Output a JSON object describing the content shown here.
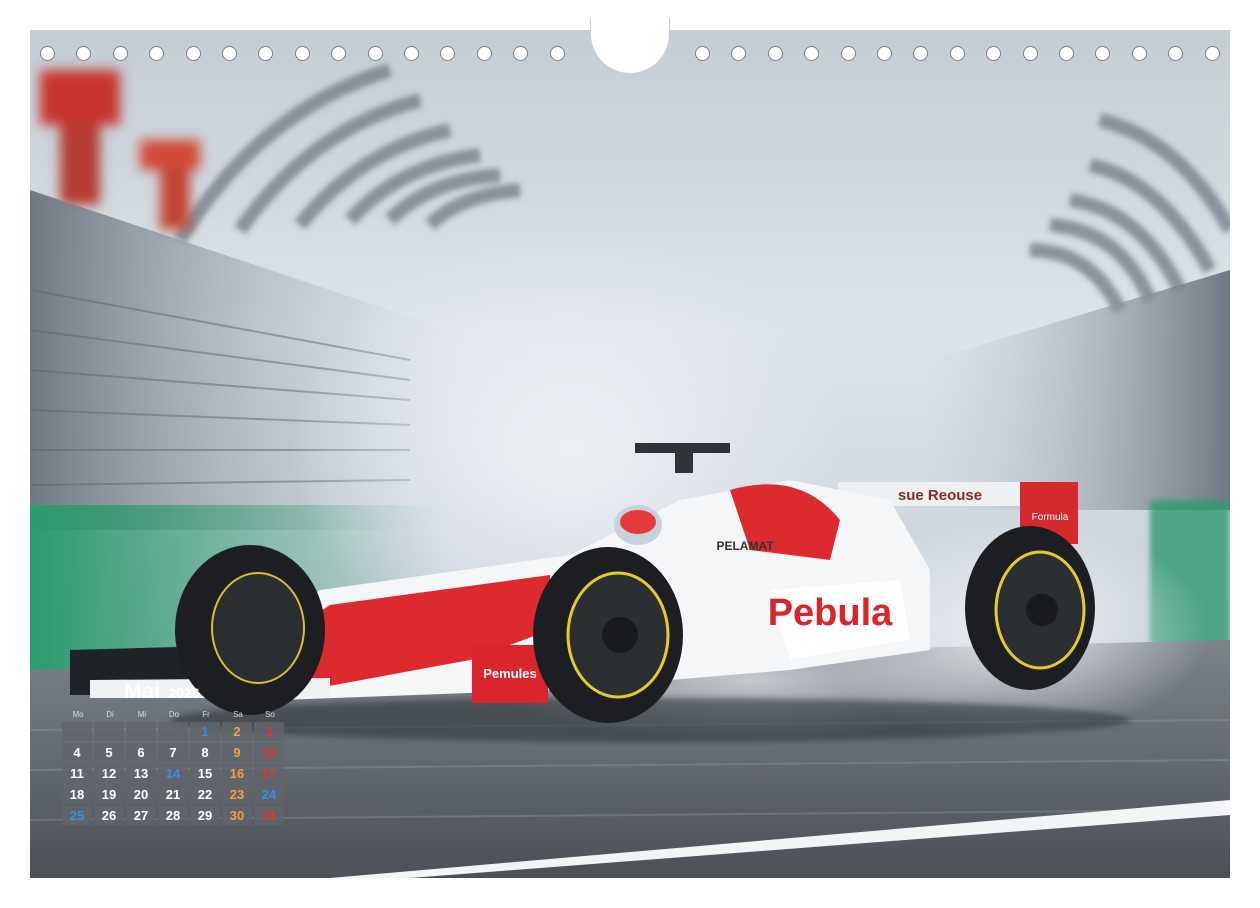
{
  "calendar": {
    "month": "Mai",
    "year": "2026",
    "weekdays": [
      "Mo",
      "Di",
      "Mi",
      "Do",
      "Fr",
      "Sa",
      "So"
    ],
    "weeks": [
      [
        "",
        "",
        "",
        "",
        "1",
        "2",
        "3"
      ],
      [
        "4",
        "5",
        "6",
        "7",
        "8",
        "9",
        "10"
      ],
      [
        "11",
        "12",
        "13",
        "14",
        "15",
        "16",
        "17"
      ],
      [
        "18",
        "19",
        "20",
        "21",
        "22",
        "23",
        "24"
      ],
      [
        "25",
        "26",
        "27",
        "28",
        "29",
        "30",
        "31"
      ]
    ],
    "holidays": [
      "1",
      "14",
      "24",
      "25"
    ],
    "colors": {
      "saturday": "#f4a23c",
      "sunday": "#e2372f",
      "holiday": "#3a8fe6",
      "weekday": "#ffffff"
    }
  },
  "photo": {
    "subject": "racing-car-photo",
    "car_livery": [
      "Pebula",
      "Pemules",
      "Formula",
      "PELAMAT",
      "sue Reouse"
    ],
    "colors": {
      "body": "#ffffff",
      "accent": "#e3232c",
      "track": "#5c6168",
      "curb": "#2f9b6e",
      "mist": "#dfe5ec"
    }
  },
  "binding": {
    "rings": 31
  }
}
